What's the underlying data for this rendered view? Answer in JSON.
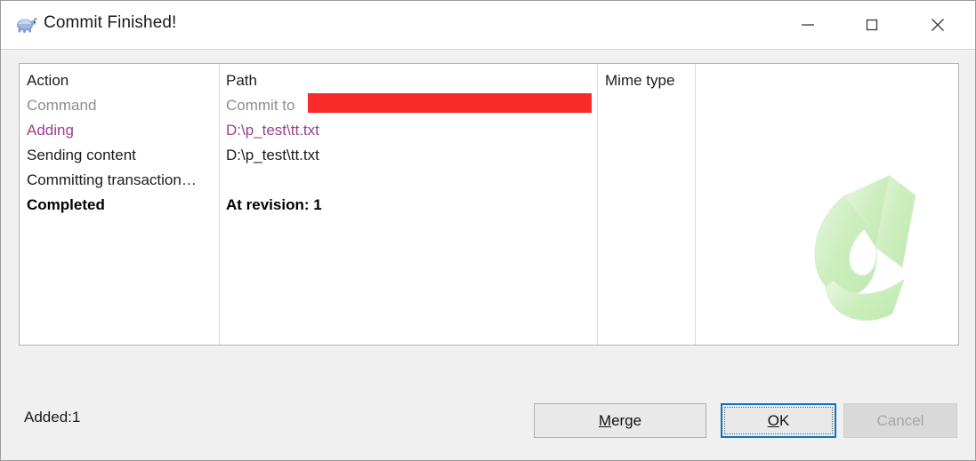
{
  "window": {
    "title": "Commit Finished!",
    "icon": "tortoise-icon",
    "controls": {
      "minimize": "minimize-icon",
      "maximize": "maximize-icon",
      "close": "close-icon"
    }
  },
  "list": {
    "columns": [
      "Action",
      "Path",
      "Mime type"
    ],
    "rows": [
      {
        "action": "Command",
        "path": "Commit to",
        "mime": "",
        "style": "gray",
        "redacted": true
      },
      {
        "action": "Adding",
        "path": "D:\\p_test\\tt.txt",
        "mime": "",
        "style": "purple",
        "redacted": false
      },
      {
        "action": "Sending content",
        "path": "D:\\p_test\\tt.txt",
        "mime": "",
        "style": "normal",
        "redacted": false
      },
      {
        "action": "Committing transaction…",
        "path": "",
        "mime": "",
        "style": "normal",
        "redacted": false
      },
      {
        "action": "Completed",
        "path": "At revision: 1",
        "mime": "",
        "style": "bold",
        "redacted": false
      }
    ]
  },
  "watermark": {
    "name": "green-curved-arrow-watermark",
    "color": "#cdf0c2"
  },
  "footer": {
    "status": "Added:1",
    "buttons": {
      "merge": {
        "label": "Merge",
        "accel": "M",
        "disabled": false,
        "focused": false
      },
      "ok": {
        "label": "OK",
        "accel": "O",
        "disabled": false,
        "focused": true
      },
      "cancel": {
        "label": "Cancel",
        "accel": "",
        "disabled": true,
        "focused": false
      }
    }
  },
  "colors": {
    "accent": "#0a72c6",
    "redaction": "#f82a2a",
    "purple_row": "#9c3d90",
    "gray_row": "#8c8c8c",
    "dialog_bg": "#f0f0f0"
  }
}
